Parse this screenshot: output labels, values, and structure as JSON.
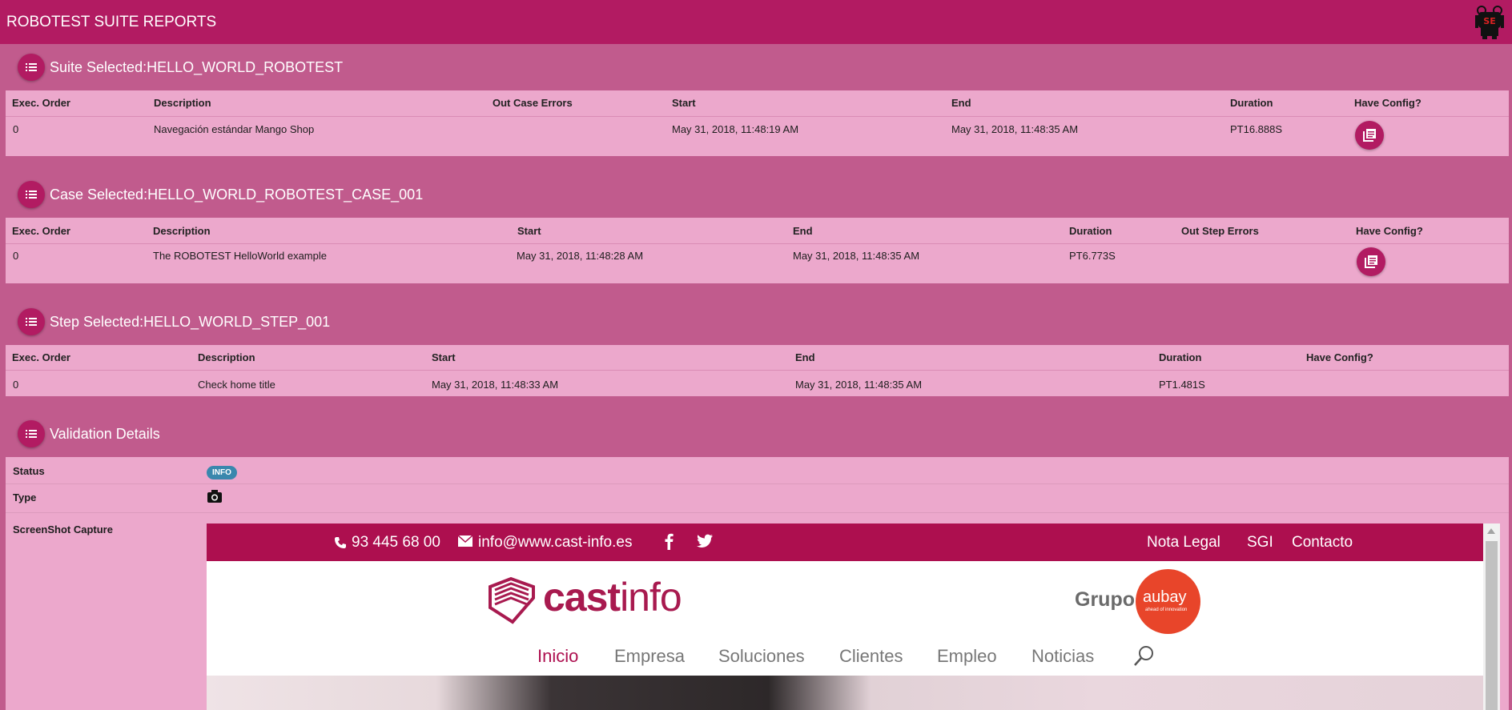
{
  "app": {
    "title": "ROBOTEST SUITE REPORTS",
    "logo_icon": "robot-logo-icon"
  },
  "colors": {
    "primary": "#b21b62",
    "background": "#c15b8d",
    "panel": "#eca8cc",
    "info_badge": "#3a87ad"
  },
  "suite": {
    "heading": "Suite Selected:HELLO_WORLD_ROBOTEST",
    "columns": [
      "Exec. Order",
      "Description",
      "Out Case Errors",
      "Start",
      "End",
      "Duration",
      "Have Config?"
    ],
    "row": {
      "exec_order": "0",
      "description": "Navegación estándar Mango Shop",
      "out_case_errors": "",
      "start": "May 31, 2018, 11:48:19 AM",
      "end": "May 31, 2018, 11:48:35 AM",
      "duration": "PT16.888S"
    }
  },
  "case": {
    "heading": "Case Selected:HELLO_WORLD_ROBOTEST_CASE_001",
    "columns": [
      "Exec. Order",
      "Description",
      "Start",
      "End",
      "Duration",
      "Out Step Errors",
      "Have Config?"
    ],
    "row": {
      "exec_order": "0",
      "description": "The ROBOTEST HelloWorld example",
      "start": "May 31, 2018, 11:48:28 AM",
      "end": "May 31, 2018, 11:48:35 AM",
      "duration": "PT6.773S",
      "out_step_errors": ""
    }
  },
  "step": {
    "heading": "Step Selected:HELLO_WORLD_STEP_001",
    "columns": [
      "Exec. Order",
      "Description",
      "Start",
      "End",
      "Duration",
      "Have Config?"
    ],
    "row": {
      "exec_order": "0",
      "description": "Check home title",
      "start": "May 31, 2018, 11:48:33 AM",
      "end": "May 31, 2018, 11:48:35 AM",
      "duration": "PT1.481S",
      "have_config": ""
    }
  },
  "validation": {
    "heading": "Validation Details",
    "status_label": "Status",
    "status_value": "INFO",
    "type_label": "Type",
    "type_icon": "camera-icon",
    "screenshot_label": "ScreenShot Capture"
  },
  "capture": {
    "phone": "93 445 68 00",
    "email": "info@www.cast-info.es",
    "top_links": [
      "Nota Legal",
      "SGI",
      "Contacto"
    ],
    "logo_cast": "cast",
    "logo_info": "info",
    "grupo": "Grupo",
    "aubay": "aubay",
    "aubay_tagline": "ahead of innovation",
    "menu": [
      "Inicio",
      "Empresa",
      "Soluciones",
      "Clientes",
      "Empleo",
      "Noticias"
    ]
  }
}
